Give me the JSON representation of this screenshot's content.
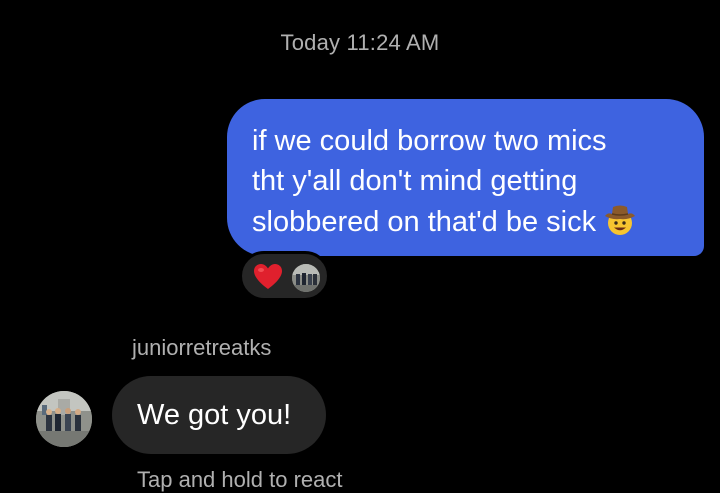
{
  "conversation": {
    "timestamp": "Today 11:24 AM",
    "sent_message": {
      "lines": [
        "if we could borrow two mics",
        "tht y'all don't mind getting",
        "slobbered on that'd be sick"
      ],
      "emoji": "cowboy-hat-face-emoji",
      "reactions": {
        "emoji": "red-heart-emoji"
      }
    },
    "received_message": {
      "sender": "juniorretreatks",
      "text": "We got you!",
      "hint": "Tap and hold to react"
    }
  },
  "colors": {
    "background": "#000000",
    "sent_bubble": "#3e63e0",
    "received_bubble": "#262626",
    "meta_text": "#b0b0b0",
    "heart": "#e0202d"
  }
}
